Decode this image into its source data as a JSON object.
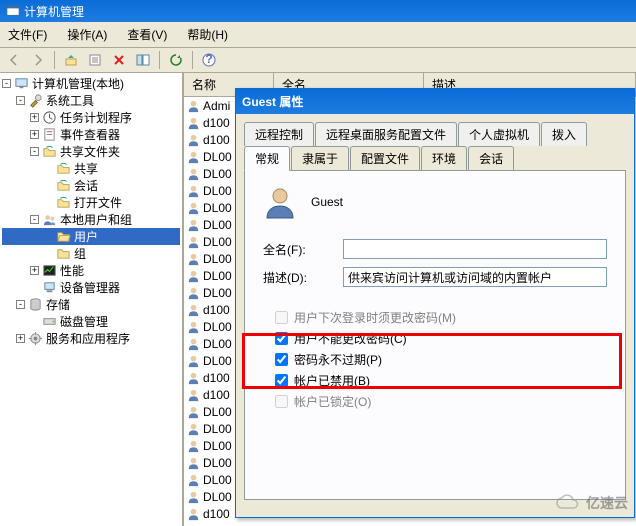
{
  "window": {
    "title": "计算机管理"
  },
  "menus": {
    "file": "文件(F)",
    "action": "操作(A)",
    "view": "查看(V)",
    "help": "帮助(H)"
  },
  "tree": {
    "root": "计算机管理(本地)",
    "system_tools": "系统工具",
    "task_scheduler": "任务计划程序",
    "event_viewer": "事件查看器",
    "shared_folders": "共享文件夹",
    "shares": "共享",
    "sessions": "会话",
    "open_files": "打开文件",
    "local_users": "本地用户和组",
    "users": "用户",
    "groups": "组",
    "performance": "性能",
    "device_mgr": "设备管理器",
    "storage": "存储",
    "disk_mgmt": "磁盘管理",
    "services_apps": "服务和应用程序"
  },
  "list": {
    "col_name": "名称",
    "col_full": "全名",
    "col_desc": "描述",
    "rows": [
      "Admi",
      "d100",
      "d100",
      "DL00",
      "DL00",
      "DL00",
      "DL00",
      "DL00",
      "DL00",
      "DL00",
      "DL00",
      "DL00",
      "d100",
      "DL00",
      "DL00",
      "DL00",
      "d100",
      "d100",
      "DL00",
      "DL00",
      "DL00",
      "DL00",
      "DL00",
      "DL00",
      "d100"
    ]
  },
  "dialog": {
    "title": "Guest 属性",
    "tabs_back": [
      "远程控制",
      "远程桌面服务配置文件",
      "个人虚拟机",
      "拨入"
    ],
    "tabs_front": [
      "常规",
      "隶属于",
      "配置文件",
      "环境",
      "会话"
    ],
    "active_tab": "常规",
    "user": "Guest",
    "fullname_label": "全名(F):",
    "fullname_value": "",
    "desc_label": "描述(D):",
    "desc_value": "供来宾访问计算机或访问域的内置帐户",
    "chk_change_next": "用户下次登录时须更改密码(M)",
    "chk_cannot_change": "用户不能更改密码(C)",
    "chk_never_expire": "密码永不过期(P)",
    "chk_disabled": "帐户已禁用(B)",
    "chk_locked": "帐户已锁定(O)"
  },
  "watermark": "亿速云"
}
